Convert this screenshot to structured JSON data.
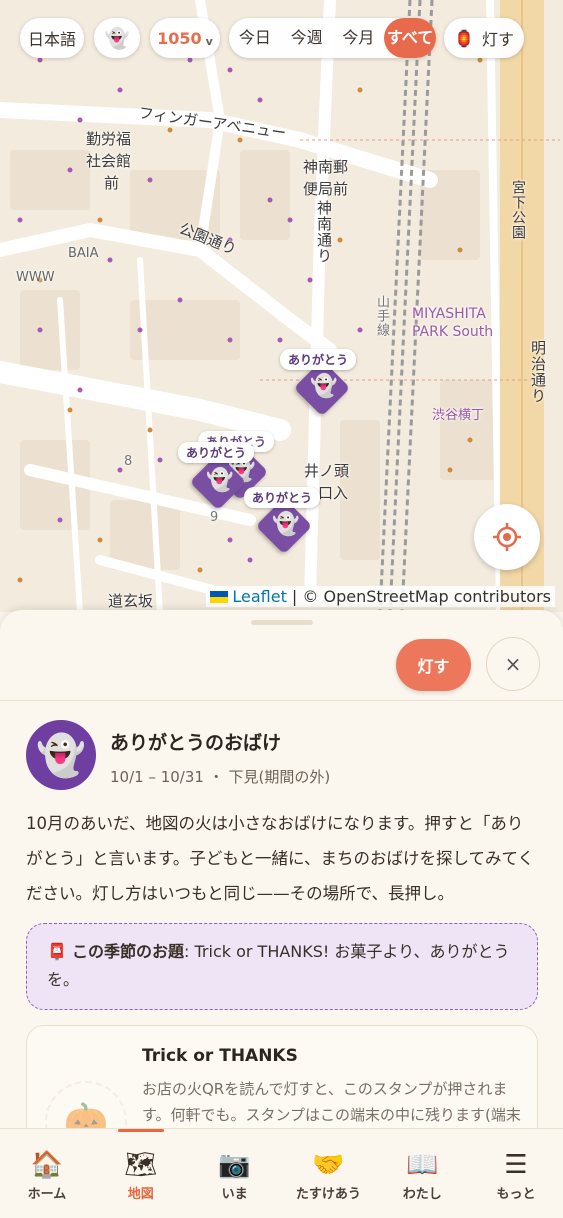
{
  "top_bar": {
    "language": "日本語",
    "ghost_icon": "ghost-icon",
    "score": "1050",
    "score_chevron": "v",
    "periods": [
      "今日",
      "今週",
      "今月",
      "すべて"
    ],
    "active_period": "すべて",
    "light_label": "灯す",
    "light_icon": "lantern-icon"
  },
  "map": {
    "labels": {
      "finger_avenue": "フィンガーアベニュー",
      "kinro": "勤労福",
      "shakaikan": "社会館",
      "mae1": "前",
      "jinnan_post": "神南郵",
      "binkyoku": "便局前",
      "jinnan_dori": "神南通り",
      "koen_dori": "公園通り",
      "baia": "BAIA",
      "www": "WWW",
      "miyashita": "MIYASHITA",
      "park_south": "PARK South",
      "yamanote": "山手線",
      "miyashita_koen": "宮下公園",
      "meiji_dori": "明治通り",
      "shibuya_yokocho": "渋谷横丁",
      "inokashira": "井ノ頭",
      "iriguchi": "口入",
      "dogenzaka": "道玄坂",
      "ichi": "8",
      "nine": "9"
    },
    "pins": [
      {
        "label": "ありがとう"
      },
      {
        "label": "ありがとう"
      },
      {
        "label": "ありがとう"
      },
      {
        "label": "ありがとう"
      }
    ],
    "attribution": {
      "leaflet": "Leaflet",
      "separator": " | © ",
      "osm": "OpenStreetMap contributors"
    }
  },
  "sheet": {
    "light_button": "灯す",
    "close_button": "×",
    "title": "ありがとうのおばけ",
    "subtitle": "10/1 – 10/31 ・ 下見(期間の外)",
    "description": "10月のあいだ、地図の火は小さなおばけになります。押すと「ありがとう」と言います。子どもと一緒に、まちのおばけを探してみてください。灯し方はいつもと同じ——その場所で、長押し。",
    "theme_label": "この季節のお題",
    "theme_text": ": Trick or THANKS! お菓子より、ありがとうを。",
    "stamp": {
      "title": "Trick or THANKS",
      "description": "お店の火QRを読んで灯すと、このスタンプが押されます。何軒でも。スタンプはこの端末の中に残ります(端末を替"
    }
  },
  "nav": {
    "items": [
      {
        "label": "ホーム",
        "icon": "🏠"
      },
      {
        "label": "地図",
        "icon": "🗺"
      },
      {
        "label": "いま",
        "icon": "📷"
      },
      {
        "label": "たすけあう",
        "icon": "🤝"
      },
      {
        "label": "わたし",
        "icon": "📖"
      },
      {
        "label": "もっと",
        "icon": "☰"
      }
    ],
    "active": "地図"
  }
}
